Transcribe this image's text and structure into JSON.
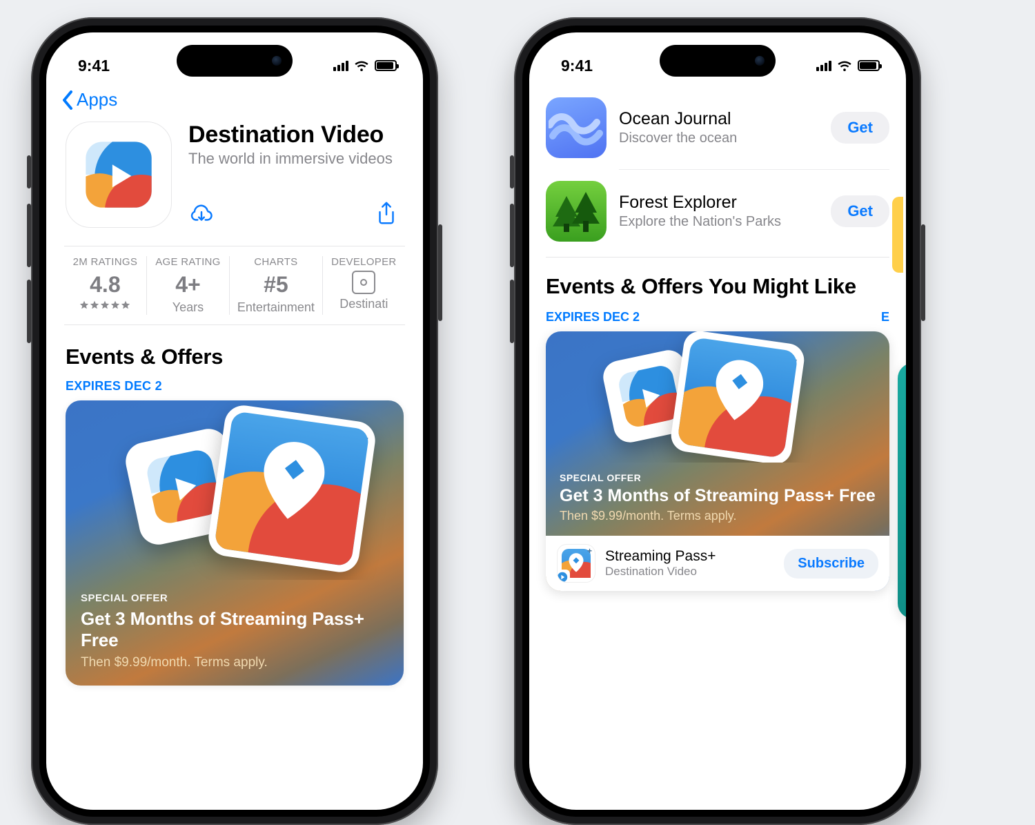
{
  "status": {
    "time": "9:41"
  },
  "left": {
    "back_label": "Apps",
    "app": {
      "title": "Destination Video",
      "subtitle": "The world in immersive videos"
    },
    "stats": {
      "ratings": {
        "label": "2M RATINGS",
        "value": "4.8"
      },
      "age": {
        "label": "AGE RATING",
        "value": "4+",
        "sub": "Years"
      },
      "charts": {
        "label": "CHARTS",
        "value": "#5",
        "sub": "Entertainment"
      },
      "dev": {
        "label": "DEVELOPER",
        "sub": "Destinati"
      }
    },
    "events_title": "Events & Offers",
    "expires": "EXPIRES DEC 2",
    "offer": {
      "kicker": "SPECIAL OFFER",
      "headline": "Get 3 Months of Streaming Pass+ Free",
      "fine": "Then $9.99/month. Terms apply."
    }
  },
  "right": {
    "apps": [
      {
        "name": "Ocean Journal",
        "desc": "Discover the ocean",
        "cta": "Get"
      },
      {
        "name": "Forest Explorer",
        "desc": "Explore the Nation's Parks",
        "cta": "Get"
      }
    ],
    "section_title": "Events & Offers You Might Like",
    "expires": "EXPIRES DEC 2",
    "expires_peek": "E",
    "offer": {
      "kicker": "SPECIAL OFFER",
      "headline": "Get 3 Months of Streaming Pass+ Free",
      "fine": "Then $9.99/month. Terms apply.",
      "product": "Streaming Pass+",
      "vendor": "Destination Video",
      "cta": "Subscribe"
    }
  }
}
